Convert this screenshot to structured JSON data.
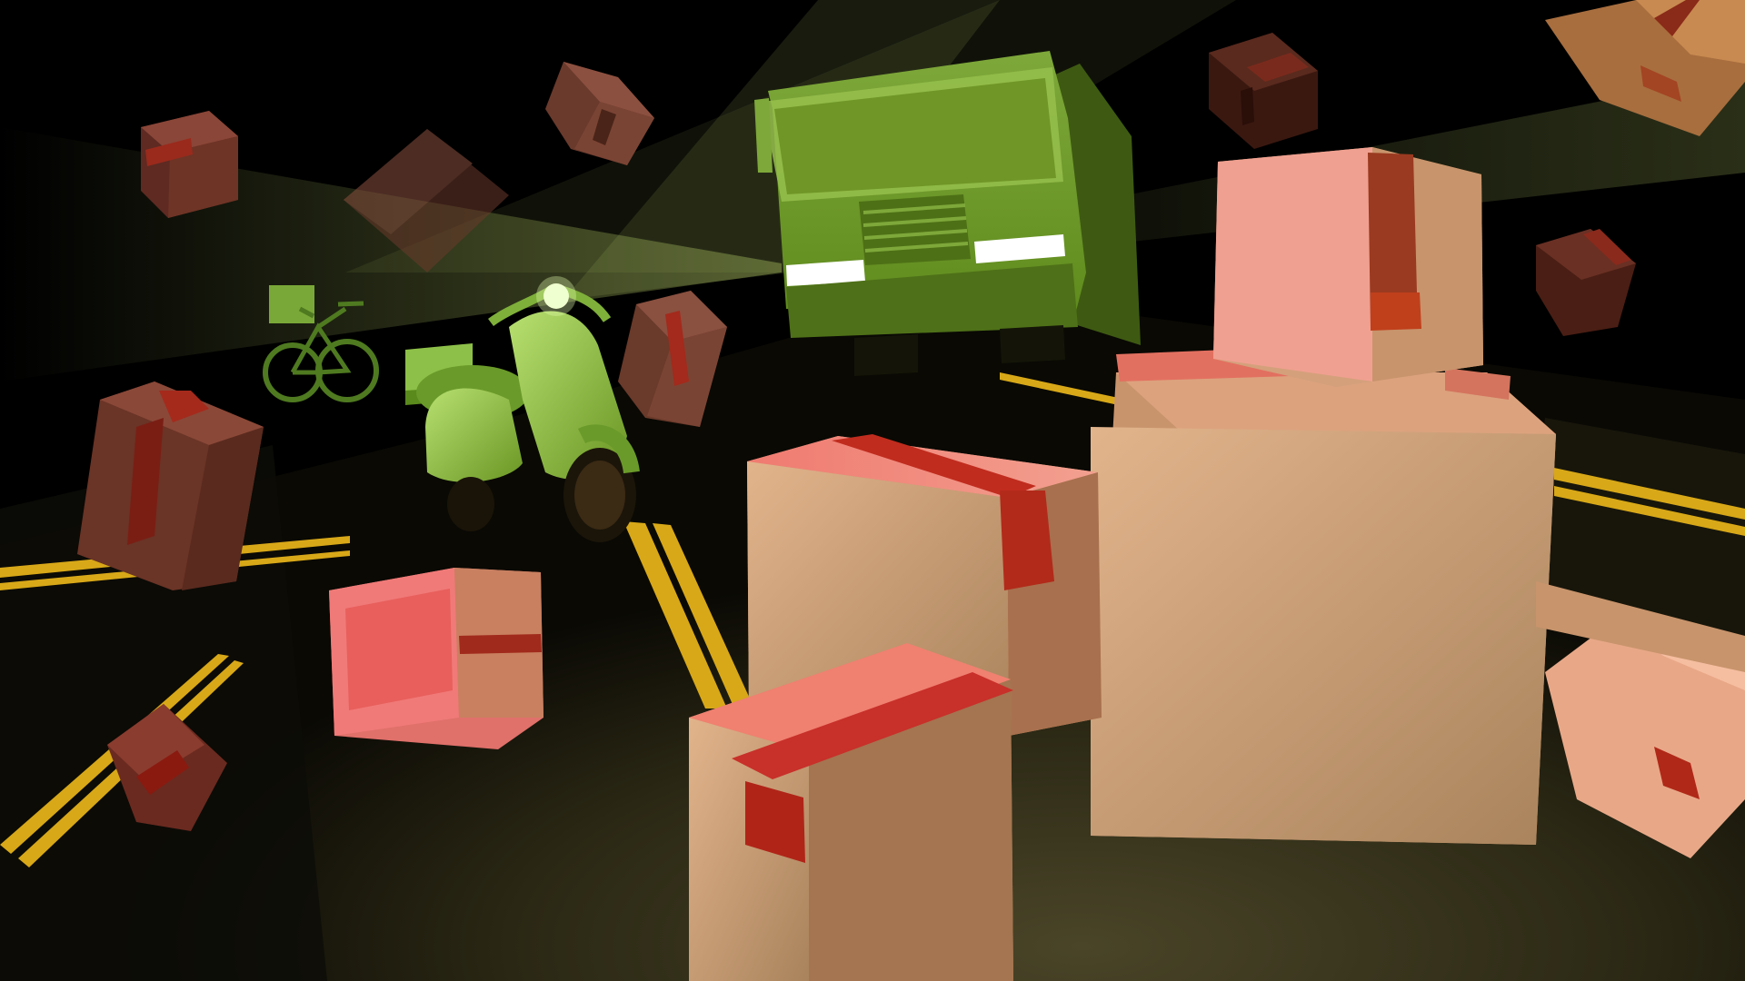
{
  "scene": {
    "palette": {
      "sky": "#000000",
      "road": "#201c10",
      "road_lit": "#3e3a20",
      "lane_yellow": "#e0b020",
      "beam": "#c8e070",
      "vehicle_green": "#8ab83a",
      "vehicle_dark": "#4e7018",
      "headlight": "#ffffff",
      "box_light": "#e8b48e",
      "box_mid": "#c8946c",
      "box_pink": "#f08078",
      "box_dark": "#7a3a30",
      "tape_red": "#b02a1c",
      "tape_dark": "#6a1e14"
    },
    "elements": {
      "truck": "delivery-truck",
      "scooter": "delivery-scooter",
      "bicycle": "delivery-bicycle",
      "boxes": "cardboard-boxes"
    }
  }
}
